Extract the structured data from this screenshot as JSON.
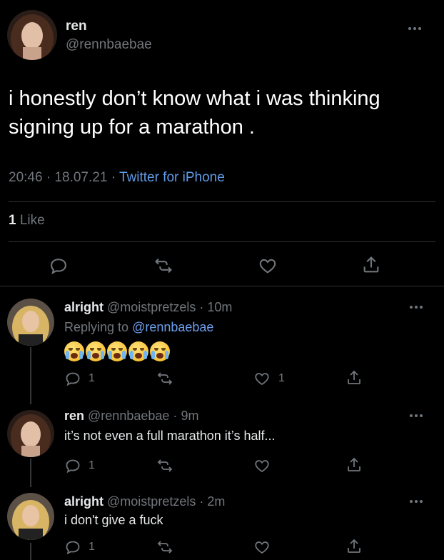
{
  "colors": {
    "background": "#000000",
    "text": "#e7e9ea",
    "muted": "#71767b",
    "link": "#5f9ce8"
  },
  "main_tweet": {
    "name": "ren",
    "handle": "@rennbaebae",
    "text": "i honestly don’t know what i was thinking signing up for a marathon .",
    "time": "20:46",
    "date": "18.07.21",
    "sep1": "·",
    "sep2": "·",
    "source": "Twitter for iPhone",
    "like_count": "1",
    "like_label": "Like"
  },
  "replies": [
    {
      "name": "alright",
      "handle": "@moistpretzels",
      "time": "10m",
      "replying_prefix": "Replying to",
      "replying_handle": "@rennbaebae",
      "emoji": "loudly-crying-face",
      "emoji_count": 5,
      "reply_count": "1",
      "like_count": "1"
    },
    {
      "name": "ren",
      "handle": "@rennbaebae",
      "time": "9m",
      "text": "it’s not even a full marathon it’s half...",
      "reply_count": "1"
    },
    {
      "name": "alright",
      "handle": "@moistpretzels",
      "time": "2m",
      "text": "i don't give a fuck",
      "reply_count": "1"
    }
  ],
  "icons": {
    "reply": "reply-icon",
    "retweet": "retweet-icon",
    "like": "heart-icon",
    "share": "share-icon",
    "more": "more-icon"
  }
}
